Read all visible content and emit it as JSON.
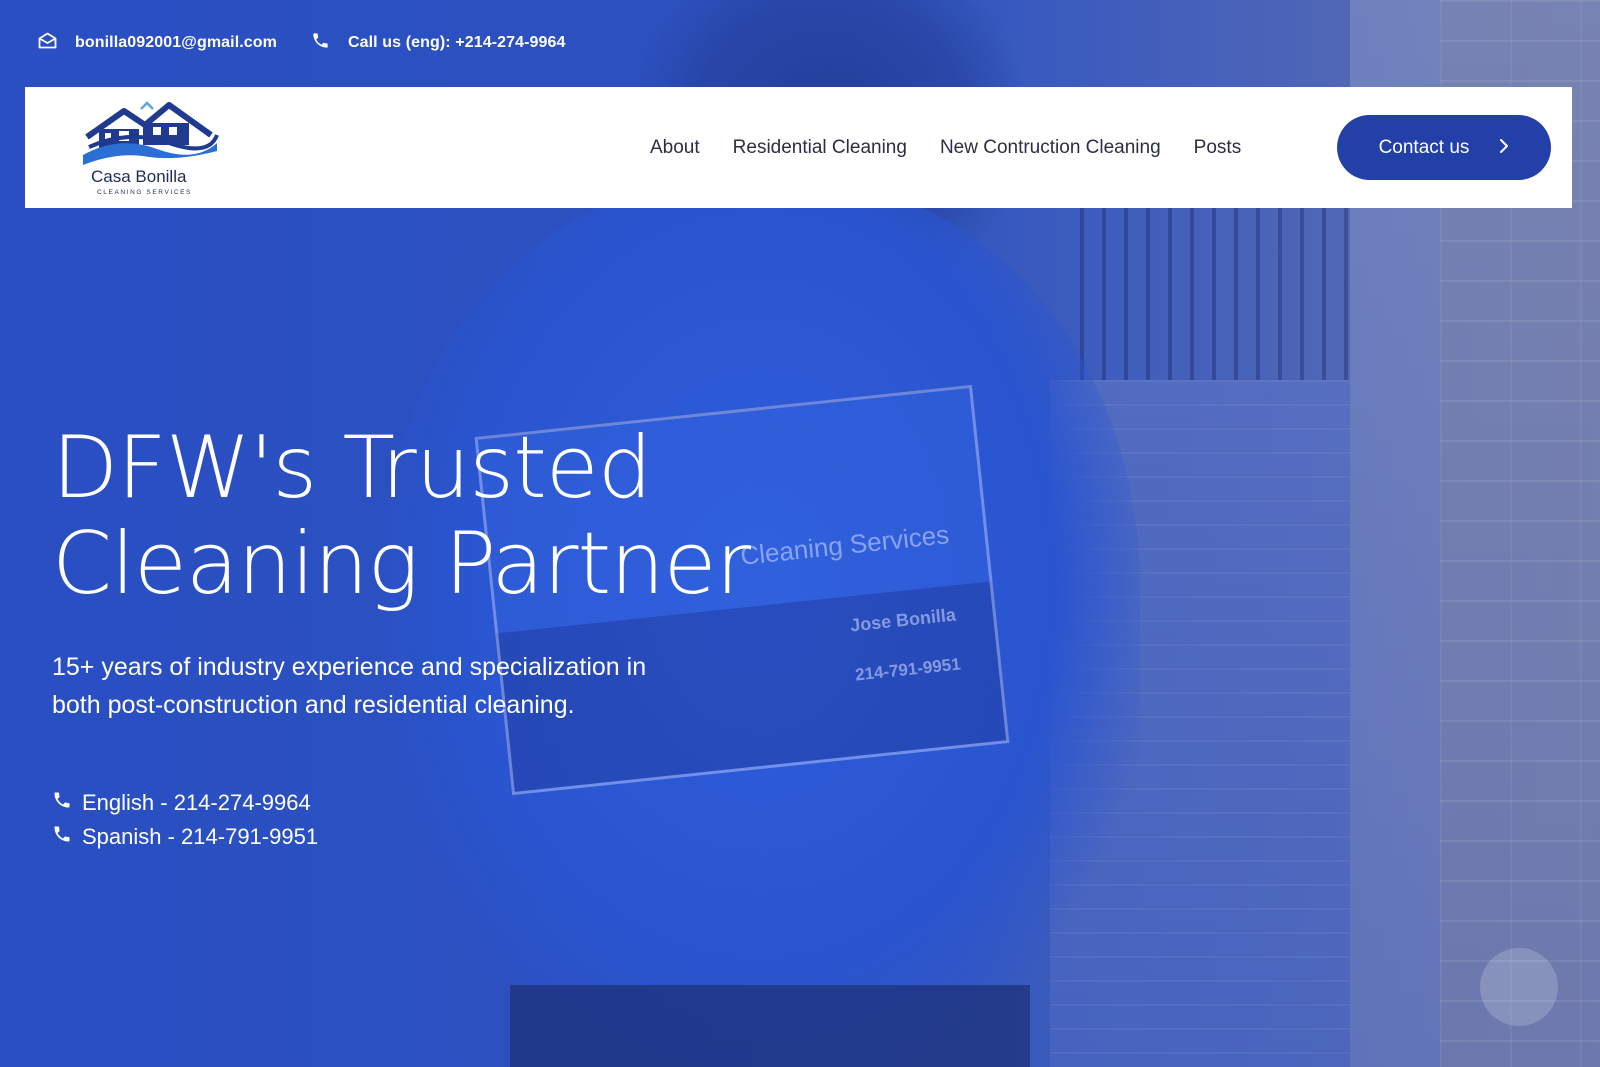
{
  "topbar": {
    "email": "bonilla092001@gmail.com",
    "phone": "Call us (eng): +214-274-9964"
  },
  "logo": {
    "title": "Casa Bonilla",
    "subtitle": "CLEANING SERVICES"
  },
  "nav": {
    "items": [
      {
        "label": "About"
      },
      {
        "label": "Residential Cleaning"
      },
      {
        "label": "New Contruction Cleaning"
      },
      {
        "label": "Posts"
      }
    ],
    "contact_label": "Contact us"
  },
  "hero": {
    "title_line1": "DFW's Trusted",
    "title_line2": "Cleaning Partner",
    "subtitle_line1": "15+ years of industry experience and specialization in",
    "subtitle_line2": "both post-construction and residential cleaning.",
    "phones": [
      {
        "label": "English - 214-274-9964"
      },
      {
        "label": "Spanish - 214-791-9951"
      }
    ]
  },
  "background_photo": {
    "shirt_text": "Cleaning Services",
    "card_name": "Jose Bonilla",
    "card_phone": "214-791-9951"
  },
  "colors": {
    "brand_blue": "#2340a8",
    "hero_overlay": "#2c4fbd",
    "nav_text": "#2a2f45"
  },
  "icons": {
    "email": "envelope-icon",
    "phone": "phone-icon",
    "chevron": "chevron-right-icon"
  }
}
